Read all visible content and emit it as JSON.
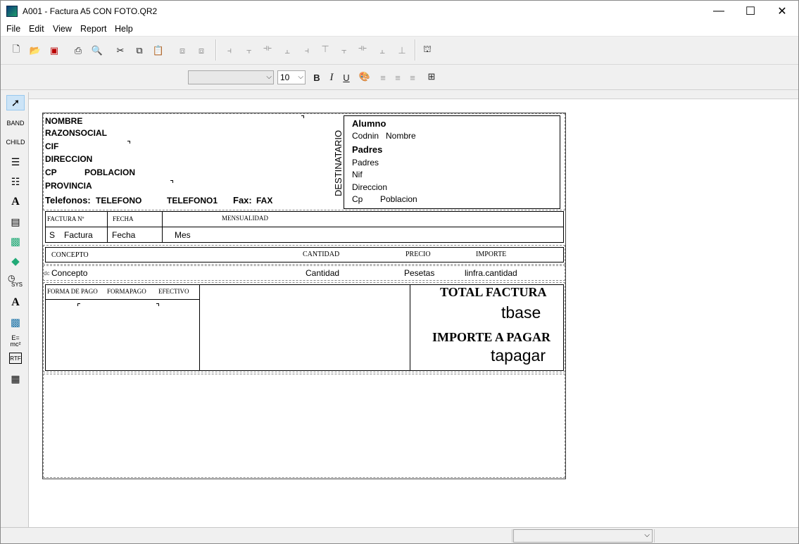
{
  "window": {
    "title": "A001 - Factura A5 CON FOTO.QR2",
    "minimize": "—",
    "maximize": "☐",
    "close": "✕"
  },
  "menu": [
    "File",
    "Edit",
    "View",
    "Report",
    "Help"
  ],
  "format_toolbar": {
    "font_name": "",
    "font_size": "10",
    "bold": "B",
    "italic": "I",
    "underline": "U"
  },
  "left_tools": {
    "band": "BAND",
    "child": "CHILD",
    "sys": "SYS",
    "expr": "E=\nmc²",
    "rtf": "RTF"
  },
  "report": {
    "header": {
      "nombre": "NOMBRE",
      "razonsocial": "RAZONSOCIAL",
      "cif": "CIF",
      "direccion": "DIRECCION",
      "cp": "CP",
      "poblacion": "POBLACION",
      "provincia": "PROVINCIA",
      "telefonos_label": "Telefonos:",
      "telefono": "TELEFONO",
      "telefono1": "TELEFONO1",
      "fax_label": "Fax:",
      "fax": "FAX",
      "destinatario": "DESTINATARIO",
      "alumno": "Alumno",
      "codnin": "Codnin",
      "nombre2": "Nombre",
      "padres_label": "Padres",
      "padres": "Padres",
      "nif": "Nif",
      "direccion2": "Direccion",
      "cp2": "Cp",
      "poblacion2": "Poblacion"
    },
    "invoice": {
      "factura_n": "FACTURA Nº",
      "fecha_label": "FECHA",
      "mensualidad": "MENSUALIDAD",
      "s": "S",
      "factura": "Factura",
      "fecha": "Fecha",
      "mes": "Mes"
    },
    "columns": {
      "concepto": "CONCEPTO",
      "cantidad": "CANTIDAD",
      "precio": "PRECIO",
      "importe": "IMPORTE"
    },
    "detail": {
      "marker": "dc",
      "concepto": "Concepto",
      "cantidad": "Cantidad",
      "pesetas": "Pesetas",
      "importe": "linfra.cantidad"
    },
    "footer": {
      "forma_pago_label": "FORMA DE PAGO",
      "formapago": "FORMAPAGO",
      "efectivo": "EFECTIVO",
      "total_factura": "TOTAL FACTURA",
      "tbase": "tbase",
      "importe_a_pagar": "IMPORTE A PAGAR",
      "tapagar": "tapagar"
    }
  }
}
